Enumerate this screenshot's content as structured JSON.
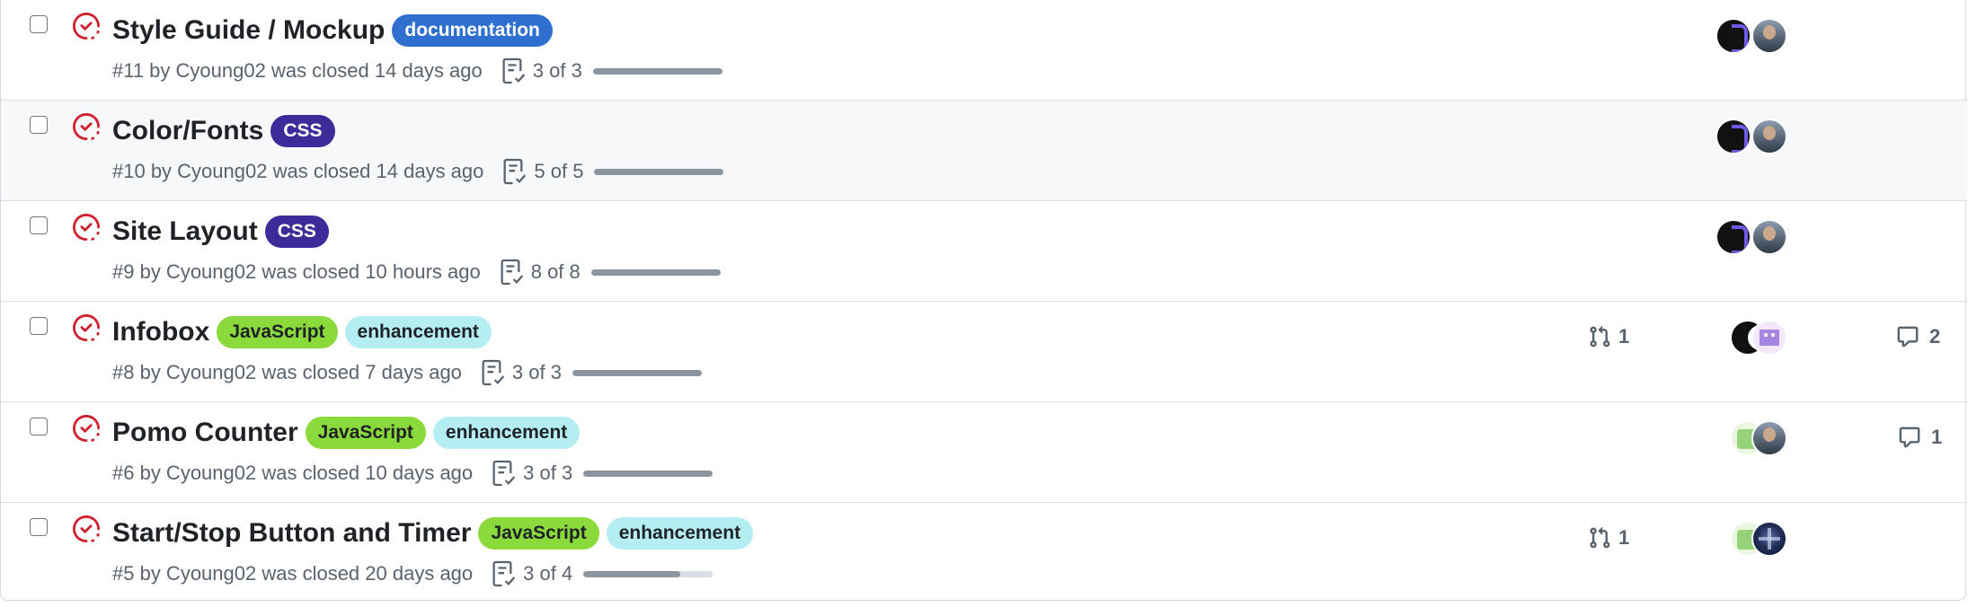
{
  "colors": {
    "closed_icon": "#cf222e",
    "label_documentation_bg": "#2f6fcf",
    "label_css_bg": "#3d2b9a",
    "label_javascript_bg": "#8ada3c",
    "label_enhancement_bg": "#b4eef2",
    "muted_text": "#59636e"
  },
  "issues": [
    {
      "title": "Style Guide / Mockup",
      "labels": [
        "documentation"
      ],
      "meta": "#11 by Cyoung02 was closed 14 days ago",
      "tasks": "3 of 3",
      "task_progress": 1.0,
      "state_icon": "issue-closed-icon",
      "avatars": [
        "avatar-dark",
        "avatar-photo"
      ]
    },
    {
      "title": "Color/Fonts",
      "labels": [
        "CSS"
      ],
      "meta": "#10 by Cyoung02 was closed 14 days ago",
      "tasks": "5 of 5",
      "task_progress": 1.0,
      "state_icon": "issue-closed-icon",
      "avatars": [
        "avatar-dark",
        "avatar-photo"
      ]
    },
    {
      "title": "Site Layout",
      "labels": [
        "CSS"
      ],
      "meta": "#9 by Cyoung02 was closed 10 hours ago",
      "tasks": "8 of 8",
      "task_progress": 1.0,
      "state_icon": "issue-closed-icon",
      "avatars": [
        "avatar-dark",
        "avatar-photo"
      ]
    },
    {
      "title": "Infobox",
      "labels": [
        "JavaScript",
        "enhancement"
      ],
      "meta": "#8 by Cyoung02 was closed 7 days ago",
      "tasks": "3 of 3",
      "task_progress": 1.0,
      "linked_prs": "1",
      "comments": "2",
      "state_icon": "issue-closed-icon",
      "avatars": [
        "avatar-dark",
        "avatar-purple"
      ]
    },
    {
      "title": "Pomo Counter",
      "labels": [
        "JavaScript",
        "enhancement"
      ],
      "meta": "#6 by Cyoung02 was closed 10 days ago",
      "tasks": "3 of 3",
      "task_progress": 1.0,
      "comments": "1",
      "state_icon": "issue-closed-icon",
      "avatars": [
        "avatar-green",
        "avatar-photo"
      ]
    },
    {
      "title": "Start/Stop Button and Timer",
      "labels": [
        "JavaScript",
        "enhancement"
      ],
      "meta": "#5 by Cyoung02 was closed 20 days ago",
      "tasks": "3 of 4",
      "task_progress": 0.75,
      "linked_prs": "1",
      "state_icon": "issue-closed-icon",
      "avatars": [
        "avatar-green",
        "avatar-space"
      ]
    }
  ]
}
